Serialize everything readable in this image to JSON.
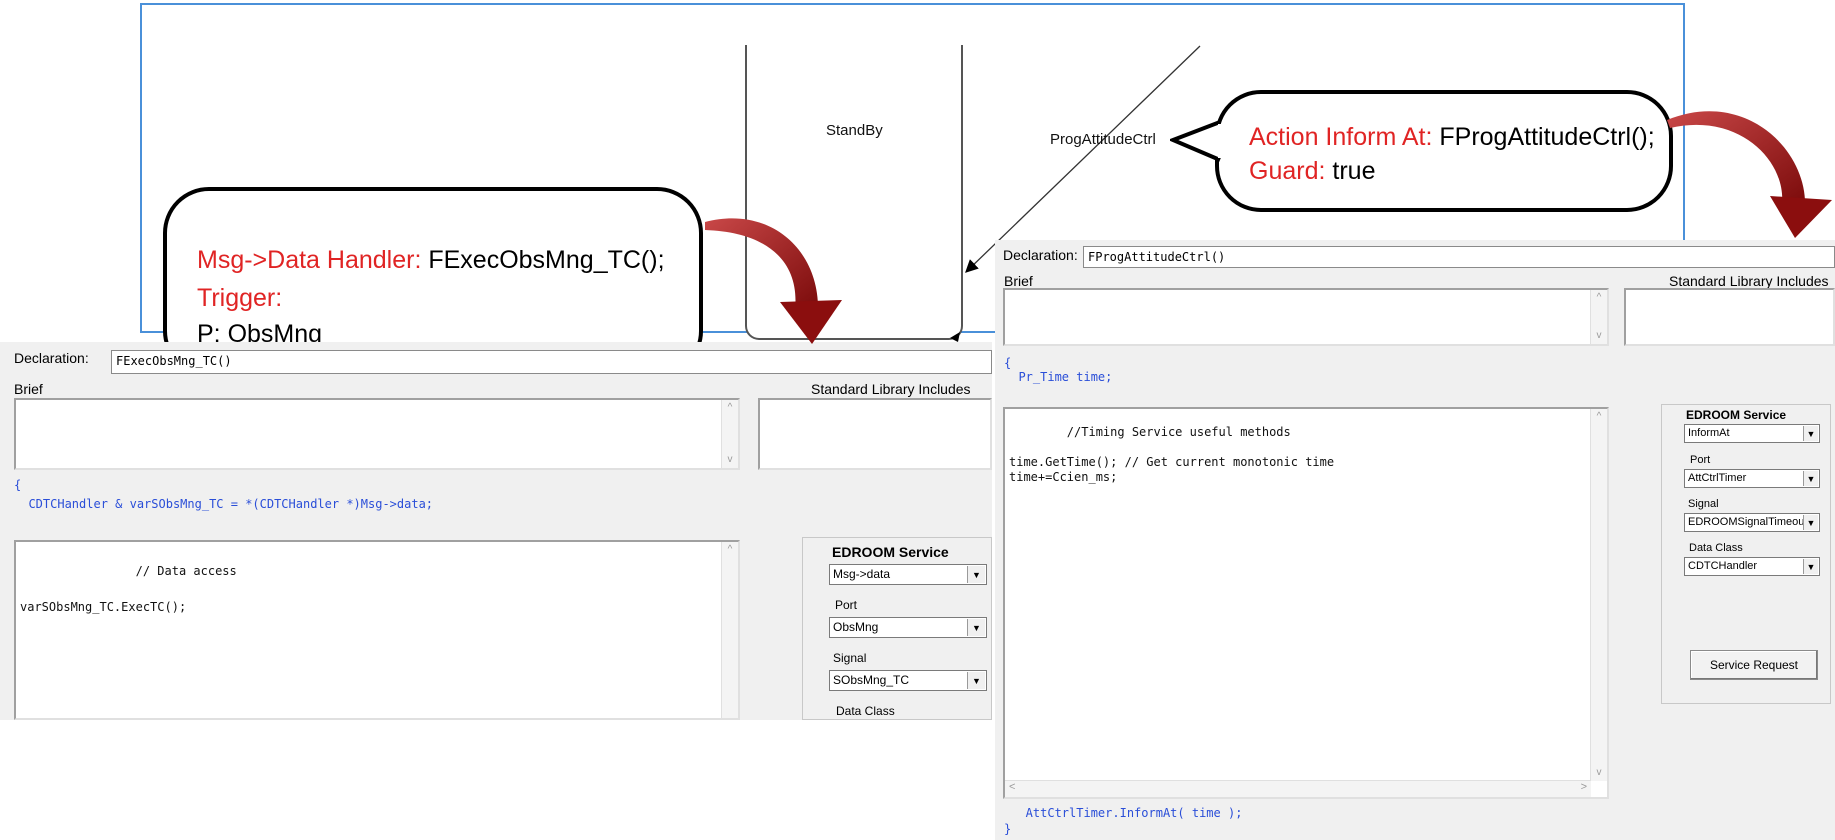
{
  "diagram": {
    "state_label": "StandBy",
    "transition_label": "ProgAttitudeCtrl"
  },
  "callout_left": {
    "line1_key": "Msg->Data Handler:",
    "line1_val": "FExecObsMng_TC();",
    "line2_key": "Trigger:",
    "line3_key": "P:",
    "line3_val": "ObsMng"
  },
  "callout_right": {
    "line1_key": "Action Inform At:",
    "line1_val": "FProgAttitudeCtrl();",
    "line2_key": "Guard:",
    "line2_val": "true"
  },
  "left_panel": {
    "declaration_label": "Declaration:",
    "declaration_value": "FExecObsMng_TC()",
    "brief_label": "Brief",
    "std_lib_label": "Standard Library Includes",
    "code_header_line1": "{",
    "code_header_line2": "  CDTCHandler & varSObsMng_TC = *(CDTCHandler *)Msg->data;",
    "code_body_line1": "                // Data access",
    "code_body_line2": "varSObsMng_TC.ExecTC();",
    "service_title": "EDROOM Service",
    "service_value": "Msg->data",
    "port_label": "Port",
    "port_value": "ObsMng",
    "signal_label": "Signal",
    "signal_value": "SObsMng_TC",
    "data_class_label": "Data Class"
  },
  "right_panel": {
    "declaration_label": "Declaration:",
    "declaration_value": "FProgAttitudeCtrl()",
    "brief_label": "Brief",
    "std_lib_label": "Standard Library Includes",
    "code_header_line1": "{",
    "code_header_line2": "  Pr_Time time;",
    "code_body_line1": "        //Timing Service useful methods",
    "code_body_line2": "time.GetTime(); // Get current monotonic time",
    "code_body_line3": "time+=Ccien_ms;",
    "code_footer_line1": "   AttCtrlTimer.InformAt( time );",
    "code_footer_line2": "}",
    "service_title": "EDROOM Service",
    "service_value": "InformAt",
    "port_label": "Port",
    "port_value": "AttCtrlTimer",
    "signal_label": "Signal",
    "signal_value": "EDROOMSignalTimeout",
    "data_class_label": "Data Class",
    "data_class_value": "CDTCHandler",
    "service_request_label": "Service Request"
  },
  "icons": {
    "dropdown": "▼",
    "scroll_up": "^",
    "scroll_down": "v",
    "scroll_left": "<",
    "scroll_right": ">"
  },
  "colors": {
    "key_red": "#e02424",
    "code_blue": "#2a4ed8",
    "frame_blue": "#4a90d9",
    "arrow_dark_red": "#8b0e0e"
  }
}
